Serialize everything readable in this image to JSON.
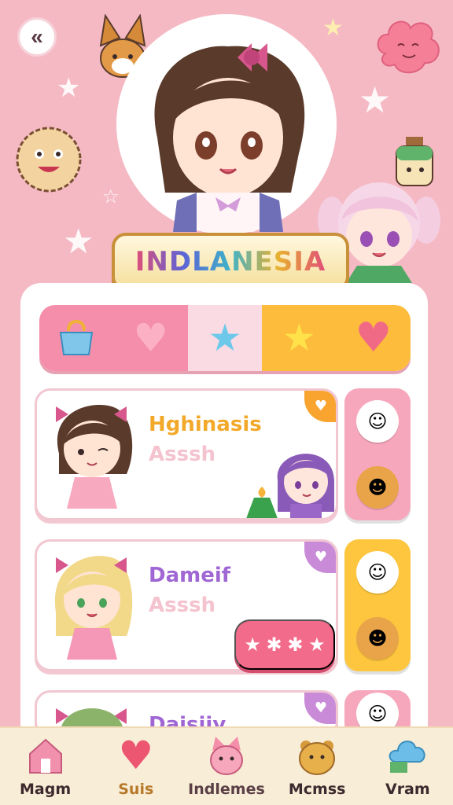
{
  "banner": {
    "title": "INDLANESIA"
  },
  "tabs": [
    {
      "icon": "bag-icon",
      "glyph": "🛍"
    },
    {
      "icon": "heart-icon",
      "glyph": "♥"
    },
    {
      "icon": "star-icon",
      "glyph": "★"
    },
    {
      "icon": "star-icon",
      "glyph": "★"
    },
    {
      "icon": "heart-icon",
      "glyph": "♥"
    }
  ],
  "cards": [
    {
      "name": "Hghinasis",
      "sub": "Asssh",
      "name_color": "#f2a92a",
      "corner_color": "#f8a42f"
    },
    {
      "name": "Dameif",
      "sub": "Asssh",
      "name_color": "#a067d4",
      "corner_color": "#c98bd8"
    },
    {
      "name": "Daisiiy",
      "sub": "",
      "name_color": "#a067d4",
      "corner_color": "#c98bd8"
    }
  ],
  "star_button": {
    "glyphs": "★ ✱ ✱ ★"
  },
  "nav": [
    {
      "label": "Magm",
      "icon": "house-icon"
    },
    {
      "label": "Suis",
      "icon": "heart-icon"
    },
    {
      "label": "Indlemes",
      "icon": "cat-icon"
    },
    {
      "label": "Mcmss",
      "icon": "bear-icon"
    },
    {
      "label": "Vram",
      "icon": "cloud-icon"
    }
  ]
}
